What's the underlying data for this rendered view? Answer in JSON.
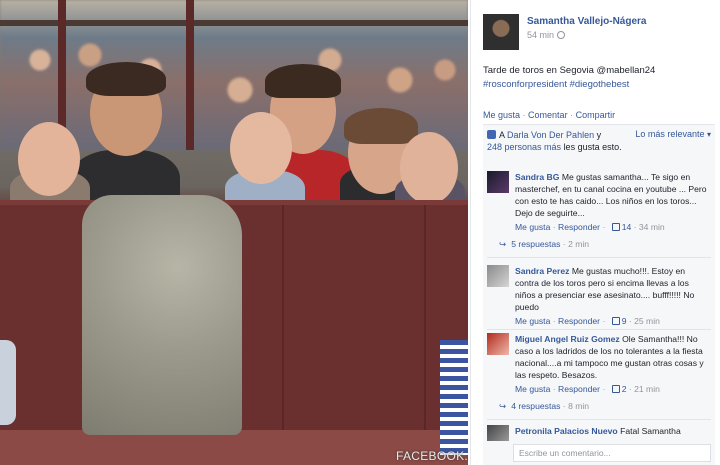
{
  "watermark": "FACEBOOK.COM/SAMANTHA VALLEJO-NAGERA",
  "post": {
    "author": "Samantha Vallejo-Nágera",
    "time": "54 min",
    "text_line1": "Tarde de toros en Segovia @mabellan24",
    "text_line2": "#rosconforpresident #diegothebest"
  },
  "actions": {
    "like": "Me gusta",
    "comment": "Comentar",
    "share": "Compartir"
  },
  "likes_summary": {
    "prefix": "A",
    "names": "Darla Von Der Pahlen",
    "middle": "y",
    "others": "248 personas más",
    "suffix": "les gusta esto."
  },
  "sort_label": "Lo más relevante",
  "comments": [
    {
      "name": "Sandra BG",
      "text": "Me gustas samantha... Te sigo en masterchef, en tu canal cocina en youtube ... Pero con esto te has caido... Los niños en los toros... Dejo de seguirte...",
      "like": "Me gusta",
      "reply": "Responder",
      "likes": "14",
      "time": "34 min",
      "replies": "5 respuestas",
      "replies_time": "2 min"
    },
    {
      "name": "Sandra Perez",
      "text": "Me gustas mucho!!!. Estoy en contra de los toros pero si encima llevas a los niños a presenciar ese asesinato.... bufff!!!!! No puedo",
      "like": "Me gusta",
      "reply": "Responder",
      "likes": "9",
      "time": "25 min"
    },
    {
      "name": "Miguel Angel Ruiz Gomez",
      "text": "Ole Samantha!!! No caso a los ladridos de los no tolerantes a la fiesta nacional....a mi tampoco me gustan otras cosas y las respeto. Besazos.",
      "like": "Me gusta",
      "reply": "Responder",
      "likes": "2",
      "time": "21 min",
      "replies": "4 respuestas",
      "replies_time": "8 min"
    },
    {
      "name": "Petronila Palacios Nuevo",
      "text": "Fatal Samantha"
    }
  ],
  "write_placeholder": "Escribe un comentario..."
}
